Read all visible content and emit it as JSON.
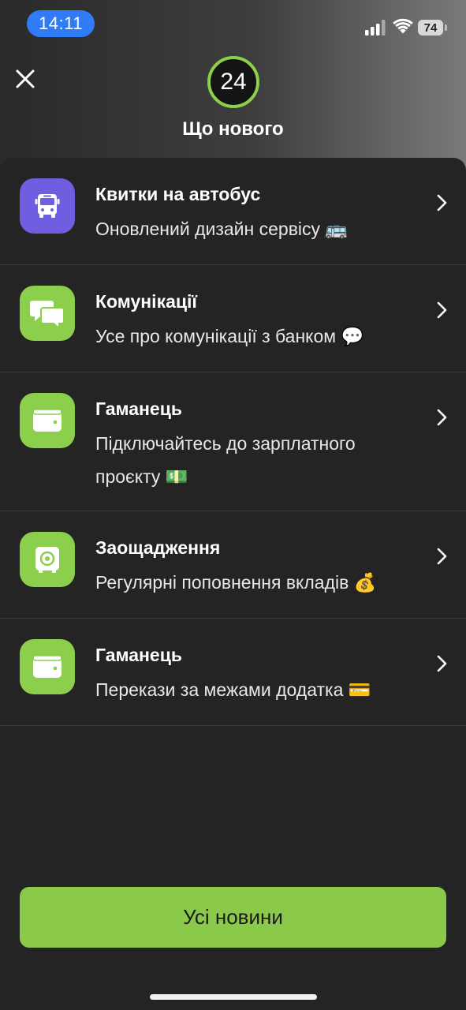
{
  "status_bar": {
    "time": "14:11",
    "battery": "74"
  },
  "header": {
    "badge_count": "24",
    "title": "Що нового"
  },
  "items": [
    {
      "title": "Квитки на автобус",
      "description": "Оновлений дизайн сервісу 🚌",
      "icon": "bus-icon",
      "icon_color": "#6f5ee0"
    },
    {
      "title": "Комунікації",
      "description": "Усе про комунікації з банком 💬",
      "icon": "chat-bubbles-icon",
      "icon_color": "#8ccf4d"
    },
    {
      "title": "Гаманець",
      "description": "Підключайтесь до зарплатного проєкту 💵",
      "icon": "wallet-icon",
      "icon_color": "#8ccf4d"
    },
    {
      "title": "Заощадження",
      "description": "Регулярні поповнення вкладів 💰",
      "icon": "safe-icon",
      "icon_color": "#8ccf4d"
    },
    {
      "title": "Гаманець",
      "description": "Перекази за межами додатка 💳",
      "icon": "wallet-icon",
      "icon_color": "#8ccf4d"
    }
  ],
  "footer": {
    "all_news_label": "Усі новини"
  },
  "colors": {
    "accent": "#8bc94a",
    "status_time_pill": "#2f7cf6",
    "sheet_background": "#242424"
  }
}
